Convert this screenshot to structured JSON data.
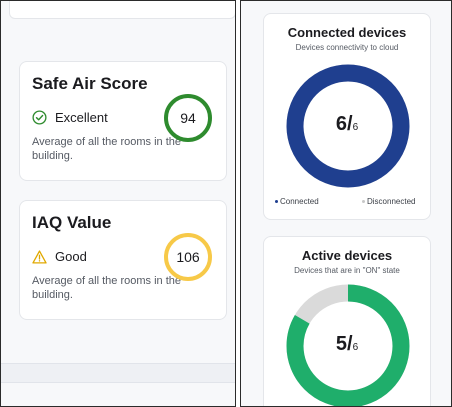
{
  "safe_air": {
    "title": "Safe Air Score",
    "status": "Excellent",
    "status_icon": "check-circle-icon",
    "value": "94",
    "description": "Average of all the rooms in the building.",
    "color": "#2e8b2e"
  },
  "iaq": {
    "title": "IAQ Value",
    "status": "Good",
    "status_icon": "warning-triangle-icon",
    "value": "106",
    "description": "Average of all the rooms in the building.",
    "color": "#f7c948"
  },
  "connected_devices": {
    "title": "Connected devices",
    "subtitle": "Devices connectivity to cloud",
    "value": "6/",
    "total": "6",
    "fraction": 1.0,
    "ring_color": "#1f3f8f",
    "track_color": "#d9d9d9",
    "legend": [
      {
        "label": "Connected",
        "color": "#1f3f8f"
      },
      {
        "label": "Disconnected",
        "color": "#c8c8c8"
      }
    ]
  },
  "active_devices": {
    "title": "Active devices",
    "subtitle": "Devices that are in \"ON\" state",
    "value": "5/",
    "total": "6",
    "fraction": 0.8333,
    "ring_color": "#1fae6b",
    "track_color": "#dadada"
  }
}
